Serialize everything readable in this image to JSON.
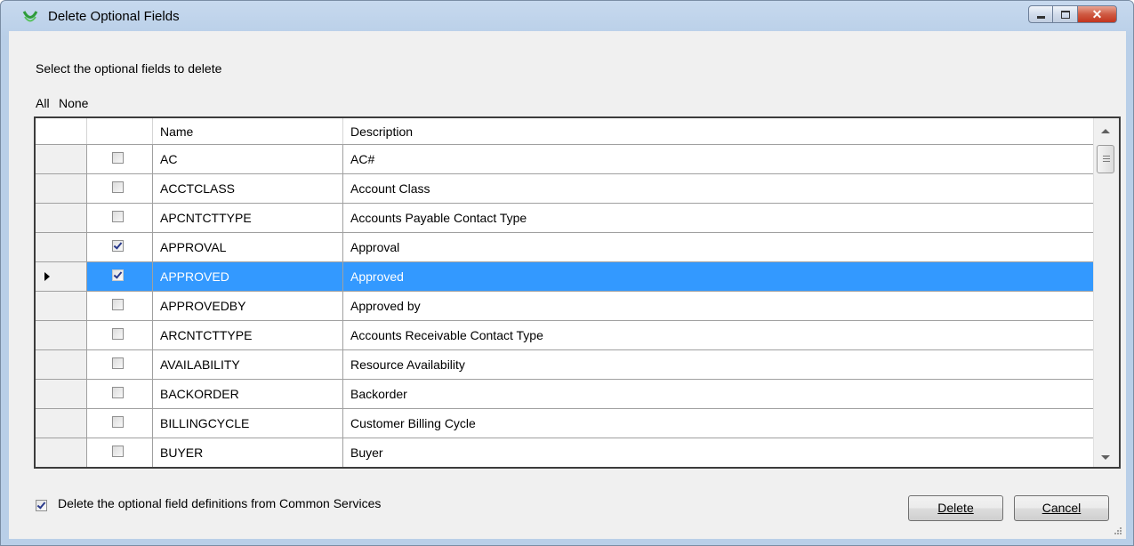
{
  "window": {
    "title": "Delete Optional Fields",
    "icon": "green-swirl-app-icon",
    "buttons": [
      "minimize",
      "maximize",
      "close"
    ]
  },
  "prompt": "Select the optional fields to delete",
  "links": {
    "all": "All",
    "none": "None"
  },
  "grid": {
    "columns": [
      "Name",
      "Description"
    ],
    "rows": [
      {
        "checked": false,
        "name": "AC",
        "description": "AC#"
      },
      {
        "checked": false,
        "name": "ACCTCLASS",
        "description": "Account Class"
      },
      {
        "checked": false,
        "name": "APCNTCTTYPE",
        "description": "Accounts Payable Contact Type"
      },
      {
        "checked": true,
        "name": "APPROVAL",
        "description": "Approval"
      },
      {
        "checked": true,
        "name": "APPROVED",
        "description": "Approved",
        "selected": true
      },
      {
        "checked": false,
        "name": "APPROVEDBY",
        "description": "Approved by"
      },
      {
        "checked": false,
        "name": "ARCNTCTTYPE",
        "description": "Accounts Receivable Contact Type"
      },
      {
        "checked": false,
        "name": "AVAILABILITY",
        "description": "Resource Availability"
      },
      {
        "checked": false,
        "name": "BACKORDER",
        "description": "Backorder"
      },
      {
        "checked": false,
        "name": "BILLINGCYCLE",
        "description": "Customer Billing Cycle"
      },
      {
        "checked": false,
        "name": "BUYER",
        "description": "Buyer"
      }
    ]
  },
  "option": {
    "checked": true,
    "label": "Delete the optional field definitions from Common Services"
  },
  "buttons": {
    "delete": "Delete",
    "cancel": "Cancel"
  },
  "colors": {
    "selection": "#3399ff",
    "window_frame": "#b9cfe8",
    "client": "#f0f0f0"
  }
}
